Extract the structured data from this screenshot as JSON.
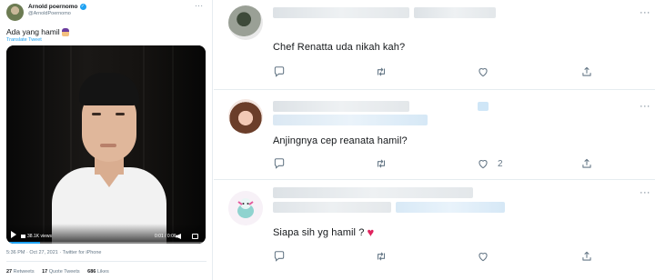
{
  "tweet": {
    "author_name": "Arnold poernomo",
    "author_handle": "@ArnoldPoernomo",
    "more_label": "···",
    "text": "Ada yang hamil",
    "translate_label": "Translate Tweet",
    "video": {
      "views": "38.1K views",
      "duration": "0:01 / 0:06",
      "progress": 0.17
    },
    "timestamp": "5:36 PM · Oct 27, 2021 · Twitter for iPhone",
    "stats": [
      {
        "count": "27",
        "label": "Retweets"
      },
      {
        "count": "17",
        "label": "Quote Tweets"
      },
      {
        "count": "686",
        "label": "Likes"
      }
    ]
  },
  "replies": [
    {
      "text": "Chef Renatta uda nikah kah?",
      "like_count": "",
      "more_label": "···",
      "heart_emoji": ""
    },
    {
      "text": "Anjingnya cep reanata hamil?",
      "like_count": "2",
      "more_label": "···",
      "heart_emoji": ""
    },
    {
      "text": "Siapa sih yg hamil ?",
      "like_count": "",
      "more_label": "···",
      "heart_emoji": "♥"
    }
  ],
  "icons": {
    "reply": "comment-icon",
    "retweet": "retweet-icon",
    "like": "heart-icon",
    "share": "share-icon",
    "accent": "#1da1f2",
    "heart_color": "#e0245e"
  }
}
